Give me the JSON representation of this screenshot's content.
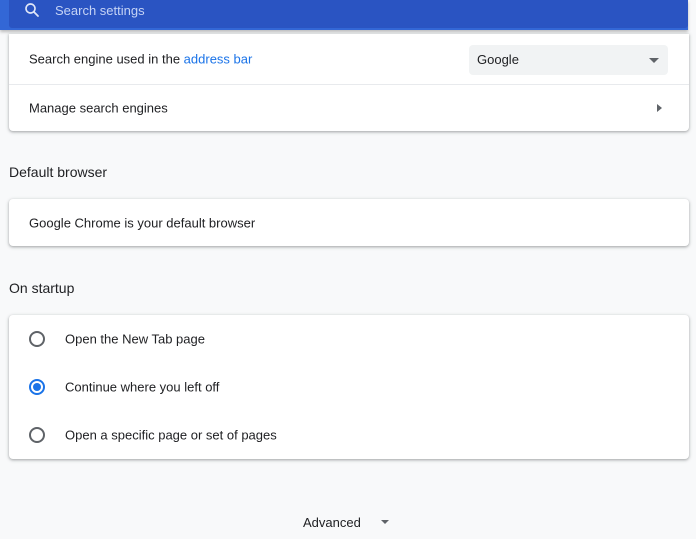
{
  "search": {
    "placeholder": "Search settings",
    "icon": "search-icon"
  },
  "search_engine": {
    "label_prefix": "Search engine used in the ",
    "label_link": "address bar",
    "selected": "Google",
    "manage_label": "Manage search engines"
  },
  "default_browser": {
    "title": "Default browser",
    "status": "Google Chrome is your default browser"
  },
  "on_startup": {
    "title": "On startup",
    "options": [
      {
        "label": "Open the New Tab page",
        "checked": false
      },
      {
        "label": "Continue where you left off",
        "checked": true
      },
      {
        "label": "Open a specific page or set of pages",
        "checked": false
      }
    ]
  },
  "advanced": {
    "label": "Advanced"
  },
  "colors": {
    "header": "#3367d6",
    "accent": "#1a73e8",
    "background": "#f8f9fa"
  }
}
